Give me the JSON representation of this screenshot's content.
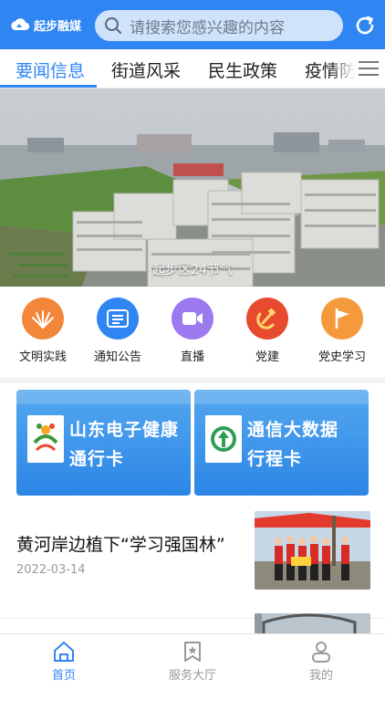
{
  "header": {
    "logo_text": "起步融媒",
    "search_placeholder": "请搜索您感兴趣的内容"
  },
  "tabs": [
    "要闻信息",
    "街道风采",
    "民生政策",
    "疫情防"
  ],
  "banner": {
    "caption": "起步区24节气"
  },
  "quick_icons": [
    {
      "label": "文明实践",
      "color": "#f2873a"
    },
    {
      "label": "通知公告",
      "color": "#2f86f3"
    },
    {
      "label": "直播",
      "color": "#9b7af0"
    },
    {
      "label": "党建",
      "color": "#e84a2f"
    },
    {
      "label": "党史学习",
      "color": "#f59a3c"
    }
  ],
  "cards": [
    {
      "line1": "山东电子健康",
      "line2": "通行卡"
    },
    {
      "line1": "通信大数据",
      "line2": "行程卡"
    }
  ],
  "news": [
    {
      "title": "黄河岸边植下“学习强国林”",
      "date": "2022-03-14"
    }
  ],
  "bottom_nav": [
    "首页",
    "服务大厅",
    "我的"
  ],
  "colors": {
    "accent": "#2f86f3"
  }
}
